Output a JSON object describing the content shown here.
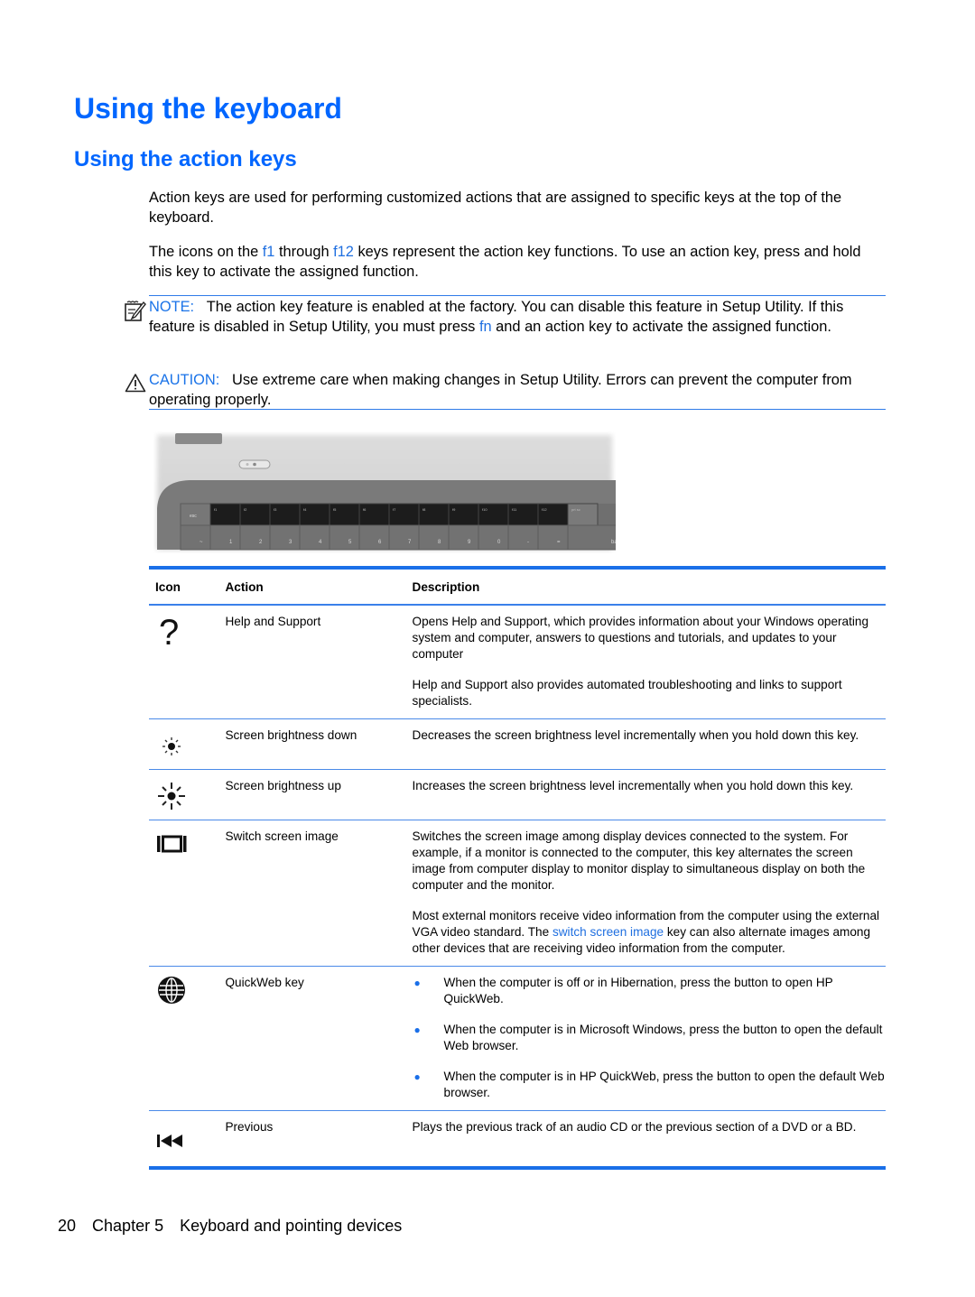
{
  "page": {
    "title": "Using the keyboard",
    "section_title": "Using the action keys"
  },
  "intro": {
    "p1": "Action keys are used for performing customized actions that are assigned to specific keys at the top of the keyboard.",
    "p2_a": "The icons on the ",
    "p2_f1": "f1",
    "p2_b": " through ",
    "p2_f12": "f12",
    "p2_c": " keys represent the action key functions. To use an action key, press and hold this key to activate the assigned function."
  },
  "note": {
    "icon": "note-pencil-icon",
    "label": "NOTE:",
    "text_a": "The action key feature is enabled at the factory. You can disable this feature in Setup Utility. If this feature is disabled in Setup Utility, you must press ",
    "fn": "fn",
    "text_b": " and an action key to activate the assigned function."
  },
  "caution": {
    "icon": "warning-triangle-icon",
    "label": "CAUTION:",
    "text": "Use extreme care when making changes in Setup Utility. Errors can prevent the computer from operating properly."
  },
  "keyboard_image": {
    "description": "Photo of laptop keyboard top row highlighting f1-f12 action keys",
    "top_row_keys": [
      "esc",
      "f1",
      "f2",
      "f3",
      "f4",
      "f5",
      "f6",
      "f7",
      "f8",
      "f9",
      "f10",
      "f11",
      "f12",
      "prt sc"
    ],
    "number_row_keys": [
      "~",
      "1",
      "2",
      "3",
      "4",
      "5",
      "6",
      "7",
      "8",
      "9",
      "0",
      "-",
      "=",
      "backspace"
    ]
  },
  "table": {
    "headers": {
      "icon": "Icon",
      "action": "Action",
      "description": "Description"
    },
    "rows": [
      {
        "icon": "question-mark-icon",
        "action": "Help and Support",
        "description": [
          "Opens Help and Support, which provides information about your Windows operating system and computer, answers to questions and tutorials, and updates to your computer",
          "Help and Support also provides automated troubleshooting and links to support specialists."
        ]
      },
      {
        "icon": "brightness-down-icon",
        "action": "Screen brightness down",
        "description": [
          "Decreases the screen brightness level incrementally when you hold down this key."
        ]
      },
      {
        "icon": "brightness-up-icon",
        "action": "Screen brightness up",
        "description": [
          "Increases the screen brightness level incrementally when you hold down this key."
        ]
      },
      {
        "icon": "switch-screen-icon",
        "action": "Switch screen image",
        "description": [
          "Switches the screen image among display devices connected to the system. For example, if a monitor is connected to the computer, this key alternates the screen image from computer display to monitor display to simultaneous display on both the computer and the monitor."
        ],
        "description_2a": "Most external monitors receive video information from the computer using the external VGA video standard. The ",
        "description_2link": "switch screen image",
        "description_2b": " key can also alternate images among other devices that are receiving video information from the computer."
      },
      {
        "icon": "globe-icon",
        "action": "QuickWeb key",
        "bullets": [
          "When the computer is off or in Hibernation, press the button to open HP QuickWeb.",
          "When the computer is in Microsoft Windows, press the button to open the default Web browser.",
          "When the computer is in HP QuickWeb, press the button to open the default Web browser."
        ]
      },
      {
        "icon": "previous-track-icon",
        "action": "Previous",
        "description": [
          "Plays the previous track of an audio CD or the previous section of a DVD or a BD."
        ]
      }
    ]
  },
  "footer": {
    "page_number": "20",
    "chapter": "Chapter 5",
    "chapter_title": "Keyboard and pointing devices"
  },
  "colors": {
    "heading": "#0066ff",
    "link": "#1f6fe0",
    "rule": "#1a6fe8"
  }
}
